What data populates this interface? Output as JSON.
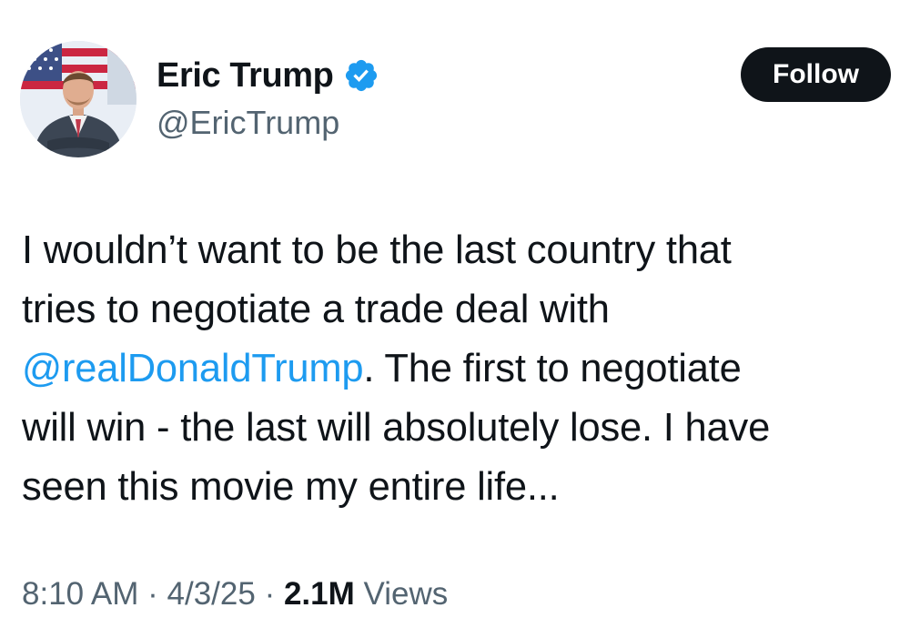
{
  "author": {
    "display_name": "Eric Trump",
    "handle": "@EricTrump",
    "verified": true,
    "verified_icon": "verified-badge-icon",
    "verified_color": "#1d9bf0"
  },
  "follow_button": {
    "label": "Follow",
    "bg_color": "#0f1419",
    "text_color": "#ffffff"
  },
  "tweet": {
    "line1": "I wouldn’t want to be the last country that",
    "line2": "tries to negotiate a trade deal with",
    "mention": "@realDonaldTrump",
    "line3_rest": ". The first to negotiate",
    "line4": "will win - the last will absolutely lose. I have",
    "line5": "seen this movie my entire life...",
    "mention_color": "#1d9bf0"
  },
  "meta": {
    "time": "8:10 AM",
    "sep1": " · ",
    "date": "4/3/25",
    "sep2": " · ",
    "views_count": "2.1M",
    "views_label": " Views"
  }
}
